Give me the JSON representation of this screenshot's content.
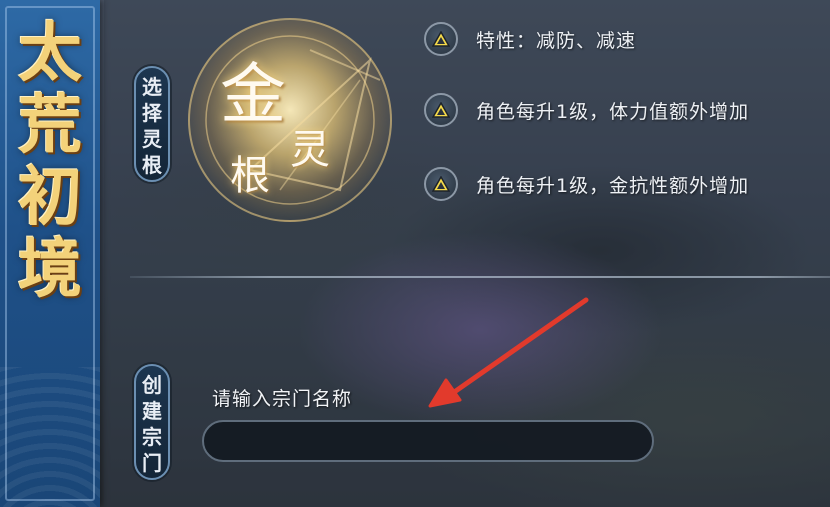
{
  "banner": {
    "title_chars": [
      "太",
      "荒",
      "初",
      "境"
    ]
  },
  "spirit_root": {
    "tab_chars": [
      "选",
      "择",
      "灵",
      "根"
    ],
    "orb_char_big": "金",
    "orb_char_ling": "灵",
    "orb_char_gen": "根",
    "traits": [
      {
        "icon": "triangle-up-icon",
        "text": "特性：减防、减速"
      },
      {
        "icon": "triangle-up-icon",
        "text": "角色每升1级，体力值额外增加"
      },
      {
        "icon": "triangle-up-icon",
        "text": "角色每升1级，金抗性额外增加"
      }
    ]
  },
  "create_sect": {
    "tab_chars": [
      "创",
      "建",
      "宗",
      "门"
    ],
    "input_label": "请输入宗门名称",
    "input_value": ""
  },
  "colors": {
    "banner_blue": "#1f5189",
    "gold_title": "#f3d27a",
    "badge_yellow": "#f4d94a",
    "arrow_red": "#e23a2c"
  }
}
